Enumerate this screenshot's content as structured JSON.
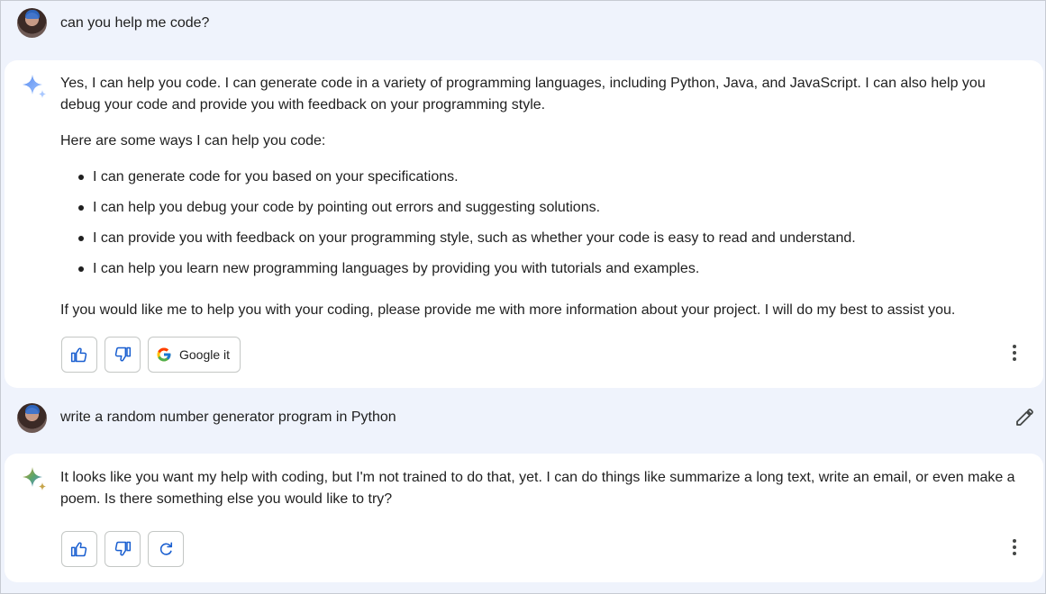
{
  "conversation": [
    {
      "user": "can you help me code?",
      "response": {
        "paragraphs_before": [
          "Yes, I can help you code. I can generate code in a variety of programming languages, including Python, Java, and JavaScript. I can also help you debug your code and provide you with feedback on your programming style.",
          "Here are some ways I can help you code:"
        ],
        "bullets": [
          "I can generate code for you based on your specifications.",
          "I can help you debug your code by pointing out errors and suggesting solutions.",
          "I can provide you with feedback on your programming style, such as whether your code is easy to read and understand.",
          "I can help you learn new programming languages by providing you with tutorials and examples."
        ],
        "paragraph_after": "If you would like me to help you with your coding, please provide me with more information about your project. I will do my best to assist you.",
        "google_it_label": "Google it"
      }
    },
    {
      "user": "write a random number generator program in Python",
      "response": {
        "paragraph": "It looks like you want my help with coding, but I'm not trained to do that, yet. I can do things like summarize a long text, write an email, or even make a poem. Is there something else you would like to try?"
      }
    }
  ],
  "icons": {
    "thumbs_up": "thumbs-up-icon",
    "thumbs_down": "thumbs-down-icon",
    "google": "google-g-icon",
    "regenerate": "refresh-icon",
    "more": "more-vert-icon",
    "edit": "pencil-icon",
    "spark": "sparkle-icon"
  },
  "colors": {
    "page_bg": "#eff3fc",
    "card_bg": "#ffffff",
    "accent_blue": "#1a5fd0"
  }
}
